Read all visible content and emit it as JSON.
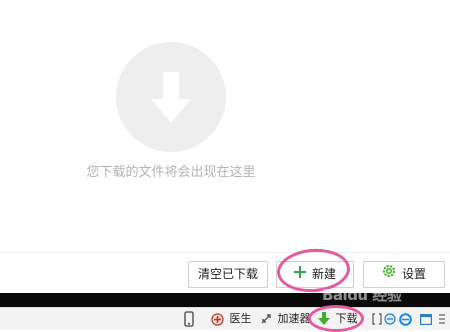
{
  "empty_state": {
    "message": "您下载的文件将会出现在这里",
    "icon": "download-arrow-icon"
  },
  "actions": {
    "clear_label": "清空已下载",
    "new_label": "新建",
    "settings_label": "设置"
  },
  "statusbar": {
    "doctor_label": "医生",
    "accelerator_label": "加速器",
    "download_label": "下载"
  },
  "watermark": "Baidu 经验",
  "colors": {
    "annotation": "#e35aa0",
    "icon_gray": "#eeeeee",
    "plus_green": "#2ea44f",
    "download_green": "#3fae2a"
  }
}
